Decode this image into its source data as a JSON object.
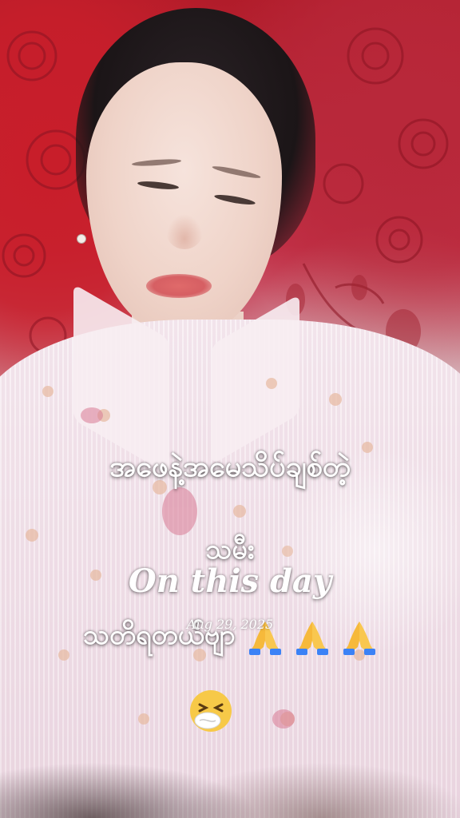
{
  "caption": {
    "line1": "အဖေနဲ့အမေသိပ်ချစ်တဲ့",
    "line2": "သမီး",
    "line3": "သတိရတယ်ဗျာ"
  },
  "memory_badge": {
    "title": "On this day",
    "date": "Aug 29, 2025"
  },
  "emojis": [
    "folded-hands",
    "folded-hands",
    "folded-hands",
    "sneezing-face"
  ],
  "colors": {
    "background_red": "#c81e2a",
    "shirt_pink": "#f1e2ea",
    "caption_text": "#ffffff"
  }
}
